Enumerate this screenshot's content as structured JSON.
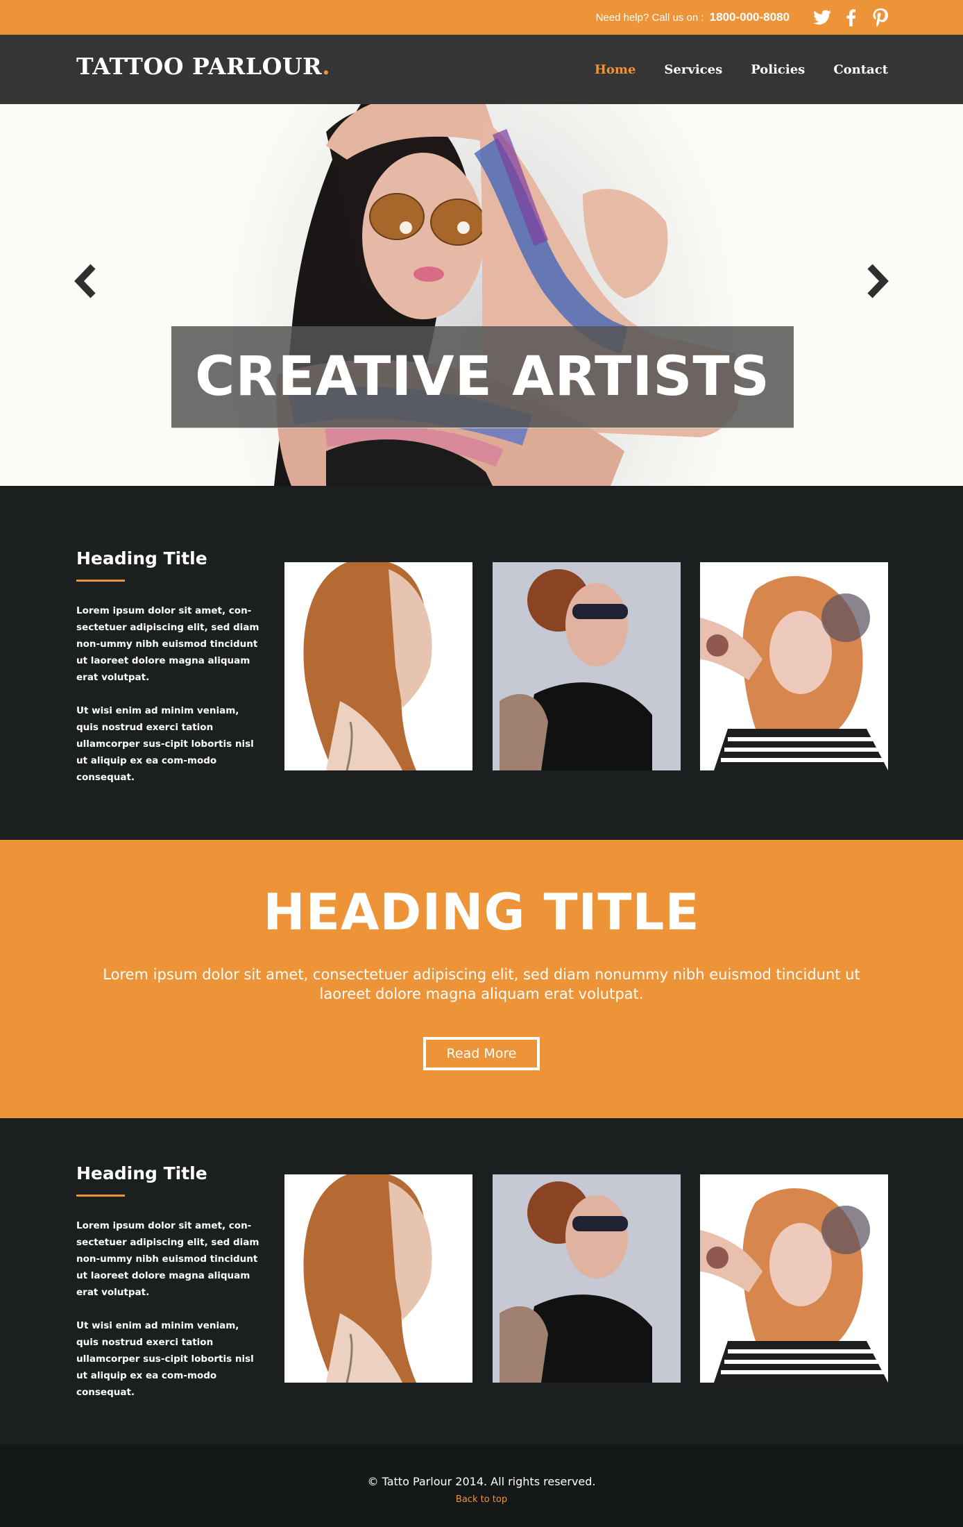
{
  "topbar": {
    "help_text": "Need help?  Call us on :",
    "phone": "1800-000-8080",
    "social": [
      "twitter-icon",
      "facebook-icon",
      "pinterest-icon"
    ]
  },
  "header": {
    "logo": "TATTOO PARLOUR",
    "logo_dot": ".",
    "nav": [
      "Home",
      "Services",
      "Policies",
      "Contact"
    ],
    "active_nav": "Home"
  },
  "hero": {
    "caption": "CREATIVE ARTISTS",
    "prev_icon": "chevron-left-icon",
    "next_icon": "chevron-right-icon"
  },
  "section1": {
    "heading": "Heading Title",
    "para1": "Lorem ipsum dolor sit amet, con-sectetuer adipiscing elit, sed diam non-ummy nibh euismod tincidunt ut laoreet dolore magna aliquam erat volutpat.",
    "para2": "Ut wisi enim ad minim veniam, quis nostrud exerci tation ullamcorper sus-cipit lobortis nisl ut aliquip ex ea com-modo consequat."
  },
  "band": {
    "heading": "HEADING TITLE",
    "text": "Lorem ipsum dolor sit amet, consectetuer adipiscing elit, sed diam nonummy nibh euismod tincidunt ut laoreet dolore magna aliquam erat volutpat.",
    "button": "Read More"
  },
  "section2": {
    "heading": "Heading Title",
    "para1": "Lorem ipsum dolor sit amet, con-sectetuer adipiscing elit, sed diam non-ummy nibh euismod tincidunt ut laoreet dolore magna aliquam erat volutpat.",
    "para2": "Ut wisi enim ad minim veniam, quis nostrud exerci tation ullamcorper sus-cipit lobortis nisl ut aliquip ex ea com-modo consequat."
  },
  "footer": {
    "copyright": "© Tatto Parlour 2014. All rights reserved.",
    "back_to_top": "Back to top"
  },
  "colors": {
    "accent": "#ed9338",
    "header_bg": "#353535",
    "section_bg": "#1b1f20",
    "footer_bg": "#151819"
  }
}
